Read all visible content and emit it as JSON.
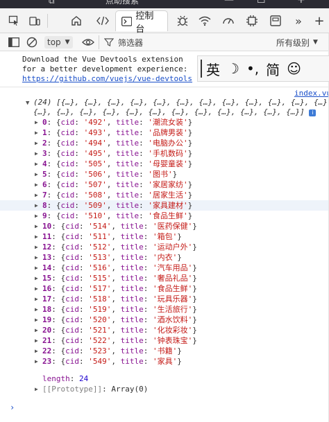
{
  "window": {
    "title_fragment": "点助搜索",
    "minimize": "—",
    "maximize": "☐",
    "close": "+"
  },
  "tabs": {
    "console_label": "控制台",
    "more": "»"
  },
  "toolbar": {
    "context": "top",
    "filter_placeholder": "筛选器",
    "levels": "所有级别"
  },
  "ime": {
    "lang": "英",
    "moon": "☽",
    "punct": "•,",
    "simp": "简",
    "emoji": "☺"
  },
  "message": {
    "text": "Download the Vue Devtools extension for a better development experience:",
    "link": "https://github.com/vuejs/vue-devtools"
  },
  "source_link": "index.vue:",
  "array_preview": {
    "line1": "(24) [{…}, {…}, {…}, {…}, {…}, {…}, {…}, {…}, {…}, {…}, {…}, {…},",
    "line2": "{…}, {…}, {…}, {…}, {…}, {…}, {…}, {…}, {…}, {…}, {…}, {…}]",
    "badge": "i"
  },
  "items": [
    {
      "idx": "0",
      "cid": "'492'",
      "title": "'潮流女装'"
    },
    {
      "idx": "1",
      "cid": "'493'",
      "title": "'品牌男装'"
    },
    {
      "idx": "2",
      "cid": "'494'",
      "title": "'电脑办公'"
    },
    {
      "idx": "3",
      "cid": "'495'",
      "title": "'手机数码'"
    },
    {
      "idx": "4",
      "cid": "'505'",
      "title": "'母婴童装'"
    },
    {
      "idx": "5",
      "cid": "'506'",
      "title": "'图书'"
    },
    {
      "idx": "6",
      "cid": "'507'",
      "title": "'家居家纺'"
    },
    {
      "idx": "7",
      "cid": "'508'",
      "title": "'居家生活'"
    },
    {
      "idx": "8",
      "cid": "'509'",
      "title": "'家具建材'"
    },
    {
      "idx": "9",
      "cid": "'510'",
      "title": "'食品生鲜'"
    },
    {
      "idx": "10",
      "cid": "'514'",
      "title": "'医药保健'"
    },
    {
      "idx": "11",
      "cid": "'511'",
      "title": "'箱包'"
    },
    {
      "idx": "12",
      "cid": "'512'",
      "title": "'运动户外'"
    },
    {
      "idx": "13",
      "cid": "'513'",
      "title": "'内衣'"
    },
    {
      "idx": "14",
      "cid": "'516'",
      "title": "'汽车用品'"
    },
    {
      "idx": "15",
      "cid": "'515'",
      "title": "'奢品礼品'"
    },
    {
      "idx": "16",
      "cid": "'517'",
      "title": "'食品生鲜'"
    },
    {
      "idx": "17",
      "cid": "'518'",
      "title": "'玩具乐器'"
    },
    {
      "idx": "18",
      "cid": "'519'",
      "title": "'生活旅行'"
    },
    {
      "idx": "19",
      "cid": "'520'",
      "title": "'酒水饮料'"
    },
    {
      "idx": "20",
      "cid": "'521'",
      "title": "'化妆彩妆'"
    },
    {
      "idx": "21",
      "cid": "'522'",
      "title": "'钟表珠宝'"
    },
    {
      "idx": "22",
      "cid": "'523'",
      "title": "'书籍'"
    },
    {
      "idx": "23",
      "cid": "'549'",
      "title": "'家具'"
    }
  ],
  "highlight_index": 8,
  "length_key": "length",
  "length_value": "24",
  "prototype_key": "[[Prototype]]",
  "prototype_value": "Array(0)",
  "prompt": "›"
}
